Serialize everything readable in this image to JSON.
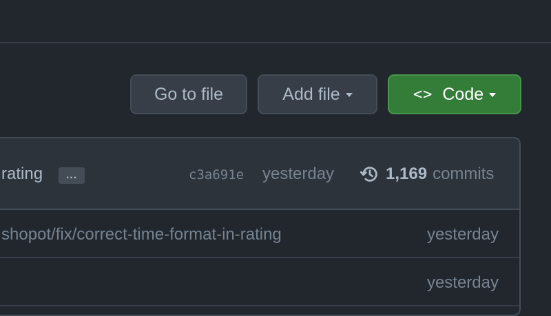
{
  "toolbar": {
    "go_to_file": "Go to file",
    "add_file": "Add file",
    "code": "Code",
    "code_glyph": "<>"
  },
  "latest_commit": {
    "message": "rating",
    "ellipsis": "...",
    "sha": "c3a691e",
    "time": "yesterday",
    "commit_count": "1,169",
    "commit_label": "commits"
  },
  "rows": [
    {
      "message": "shopot/fix/correct-time-format-in-rating",
      "time": "yesterday"
    },
    {
      "message": "",
      "time": "yesterday"
    }
  ],
  "colors": {
    "background": "#22272e",
    "panel_header": "#2d333b",
    "button": "#373e47",
    "primary_button": "#347d39",
    "border": "#444c56",
    "text": "#adbac7",
    "muted_text": "#768390"
  }
}
